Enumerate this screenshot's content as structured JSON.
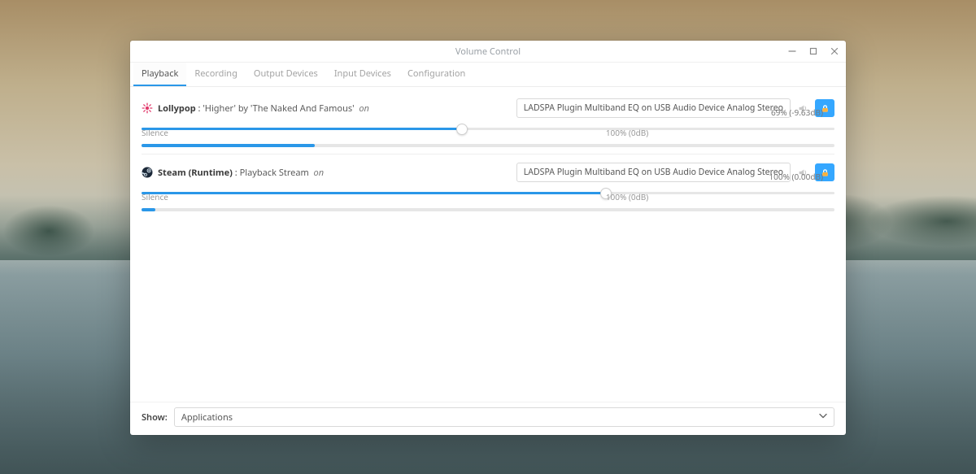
{
  "window": {
    "title": "Volume Control"
  },
  "tabs": {
    "playback": "Playback",
    "recording": "Recording",
    "output_devices": "Output Devices",
    "input_devices": "Input Devices",
    "configuration": "Configuration",
    "active": "playback"
  },
  "streams": [
    {
      "icon": "lollypop",
      "app": "Lollypop",
      "detail": ": 'Higher' by 'The Naked And Famous'",
      "on_label": "on",
      "device": "LADSPA Plugin Multiband EQ on USB Audio Device Analog Stereo",
      "readout": "69% (-9.63dB)",
      "silence_label": "Silence",
      "hundred_label": "100% (0dB)",
      "volume_percent": 69,
      "hundred_mark_percent": 67,
      "vu_percent": 25,
      "slider_width": 800
    },
    {
      "icon": "steam",
      "app": "Steam (Runtime)",
      "detail": ": Playback Stream",
      "on_label": "on",
      "device": "LADSPA Plugin Multiband EQ on USB Audio Device Analog Stereo",
      "readout": "100% (0.00dB)",
      "silence_label": "Silence",
      "hundred_label": "100% (0dB)",
      "volume_percent": 100,
      "hundred_mark_percent": 67,
      "vu_percent": 2,
      "slider_width": 800
    }
  ],
  "footer": {
    "label": "Show:",
    "value": "Applications"
  }
}
